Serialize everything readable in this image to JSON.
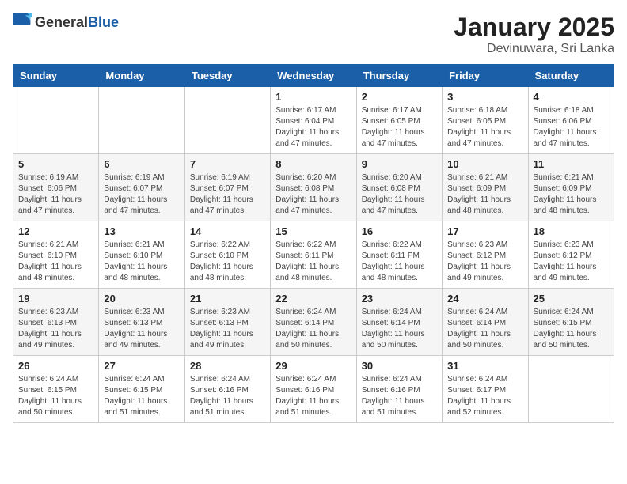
{
  "header": {
    "logo_general": "General",
    "logo_blue": "Blue",
    "month": "January 2025",
    "location": "Devinuwara, Sri Lanka"
  },
  "weekdays": [
    "Sunday",
    "Monday",
    "Tuesday",
    "Wednesday",
    "Thursday",
    "Friday",
    "Saturday"
  ],
  "weeks": [
    [
      {
        "day": "",
        "info": ""
      },
      {
        "day": "",
        "info": ""
      },
      {
        "day": "",
        "info": ""
      },
      {
        "day": "1",
        "info": "Sunrise: 6:17 AM\nSunset: 6:04 PM\nDaylight: 11 hours\nand 47 minutes."
      },
      {
        "day": "2",
        "info": "Sunrise: 6:17 AM\nSunset: 6:05 PM\nDaylight: 11 hours\nand 47 minutes."
      },
      {
        "day": "3",
        "info": "Sunrise: 6:18 AM\nSunset: 6:05 PM\nDaylight: 11 hours\nand 47 minutes."
      },
      {
        "day": "4",
        "info": "Sunrise: 6:18 AM\nSunset: 6:06 PM\nDaylight: 11 hours\nand 47 minutes."
      }
    ],
    [
      {
        "day": "5",
        "info": "Sunrise: 6:19 AM\nSunset: 6:06 PM\nDaylight: 11 hours\nand 47 minutes."
      },
      {
        "day": "6",
        "info": "Sunrise: 6:19 AM\nSunset: 6:07 PM\nDaylight: 11 hours\nand 47 minutes."
      },
      {
        "day": "7",
        "info": "Sunrise: 6:19 AM\nSunset: 6:07 PM\nDaylight: 11 hours\nand 47 minutes."
      },
      {
        "day": "8",
        "info": "Sunrise: 6:20 AM\nSunset: 6:08 PM\nDaylight: 11 hours\nand 47 minutes."
      },
      {
        "day": "9",
        "info": "Sunrise: 6:20 AM\nSunset: 6:08 PM\nDaylight: 11 hours\nand 47 minutes."
      },
      {
        "day": "10",
        "info": "Sunrise: 6:21 AM\nSunset: 6:09 PM\nDaylight: 11 hours\nand 48 minutes."
      },
      {
        "day": "11",
        "info": "Sunrise: 6:21 AM\nSunset: 6:09 PM\nDaylight: 11 hours\nand 48 minutes."
      }
    ],
    [
      {
        "day": "12",
        "info": "Sunrise: 6:21 AM\nSunset: 6:10 PM\nDaylight: 11 hours\nand 48 minutes."
      },
      {
        "day": "13",
        "info": "Sunrise: 6:21 AM\nSunset: 6:10 PM\nDaylight: 11 hours\nand 48 minutes."
      },
      {
        "day": "14",
        "info": "Sunrise: 6:22 AM\nSunset: 6:10 PM\nDaylight: 11 hours\nand 48 minutes."
      },
      {
        "day": "15",
        "info": "Sunrise: 6:22 AM\nSunset: 6:11 PM\nDaylight: 11 hours\nand 48 minutes."
      },
      {
        "day": "16",
        "info": "Sunrise: 6:22 AM\nSunset: 6:11 PM\nDaylight: 11 hours\nand 48 minutes."
      },
      {
        "day": "17",
        "info": "Sunrise: 6:23 AM\nSunset: 6:12 PM\nDaylight: 11 hours\nand 49 minutes."
      },
      {
        "day": "18",
        "info": "Sunrise: 6:23 AM\nSunset: 6:12 PM\nDaylight: 11 hours\nand 49 minutes."
      }
    ],
    [
      {
        "day": "19",
        "info": "Sunrise: 6:23 AM\nSunset: 6:13 PM\nDaylight: 11 hours\nand 49 minutes."
      },
      {
        "day": "20",
        "info": "Sunrise: 6:23 AM\nSunset: 6:13 PM\nDaylight: 11 hours\nand 49 minutes."
      },
      {
        "day": "21",
        "info": "Sunrise: 6:23 AM\nSunset: 6:13 PM\nDaylight: 11 hours\nand 49 minutes."
      },
      {
        "day": "22",
        "info": "Sunrise: 6:24 AM\nSunset: 6:14 PM\nDaylight: 11 hours\nand 50 minutes."
      },
      {
        "day": "23",
        "info": "Sunrise: 6:24 AM\nSunset: 6:14 PM\nDaylight: 11 hours\nand 50 minutes."
      },
      {
        "day": "24",
        "info": "Sunrise: 6:24 AM\nSunset: 6:14 PM\nDaylight: 11 hours\nand 50 minutes."
      },
      {
        "day": "25",
        "info": "Sunrise: 6:24 AM\nSunset: 6:15 PM\nDaylight: 11 hours\nand 50 minutes."
      }
    ],
    [
      {
        "day": "26",
        "info": "Sunrise: 6:24 AM\nSunset: 6:15 PM\nDaylight: 11 hours\nand 50 minutes."
      },
      {
        "day": "27",
        "info": "Sunrise: 6:24 AM\nSunset: 6:15 PM\nDaylight: 11 hours\nand 51 minutes."
      },
      {
        "day": "28",
        "info": "Sunrise: 6:24 AM\nSunset: 6:16 PM\nDaylight: 11 hours\nand 51 minutes."
      },
      {
        "day": "29",
        "info": "Sunrise: 6:24 AM\nSunset: 6:16 PM\nDaylight: 11 hours\nand 51 minutes."
      },
      {
        "day": "30",
        "info": "Sunrise: 6:24 AM\nSunset: 6:16 PM\nDaylight: 11 hours\nand 51 minutes."
      },
      {
        "day": "31",
        "info": "Sunrise: 6:24 AM\nSunset: 6:17 PM\nDaylight: 11 hours\nand 52 minutes."
      },
      {
        "day": "",
        "info": ""
      }
    ]
  ]
}
